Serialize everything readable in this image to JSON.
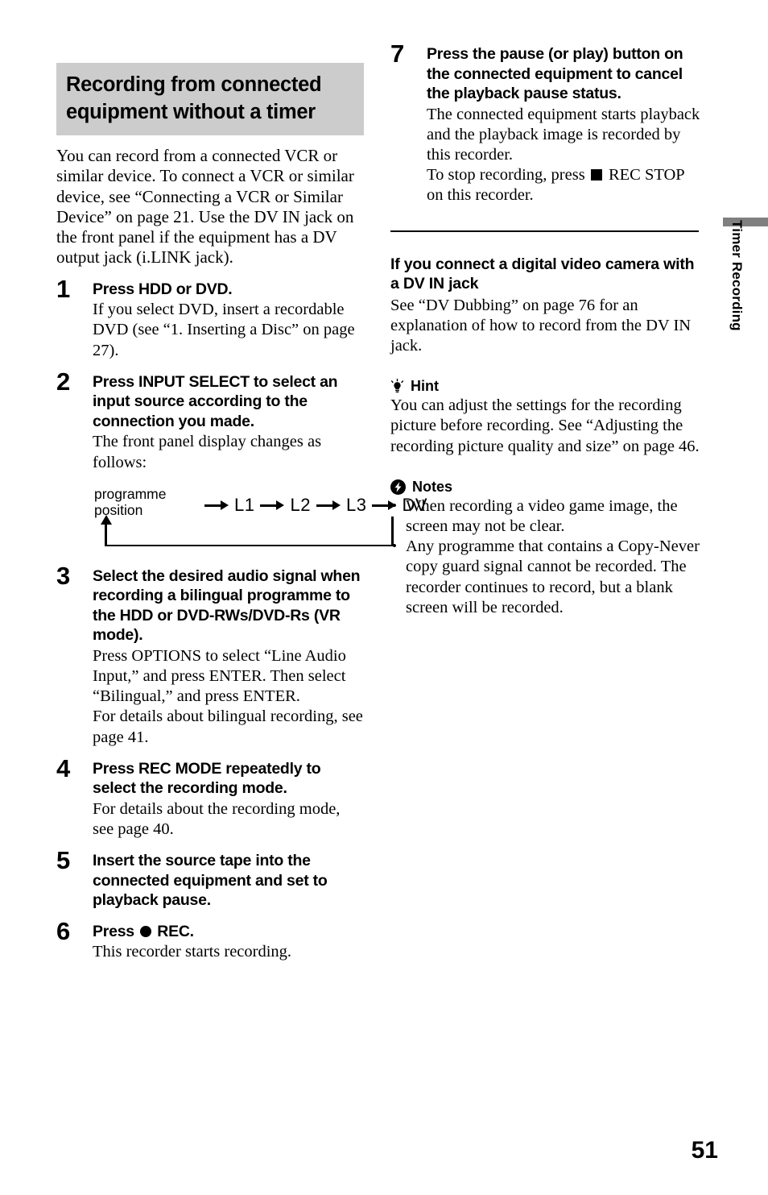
{
  "page": {
    "number": "51",
    "side_tab": "Timer Recording"
  },
  "left_column": {
    "section_heading": "Recording from connected equipment without a timer",
    "intro": "You can record from a connected VCR or similar device. To connect a VCR or similar device, see “Connecting a VCR or Similar Device” on page 21. Use the DV IN jack on the front panel if the equipment has a DV output jack (i.LINK jack).",
    "steps": [
      {
        "number": "1",
        "title": "Press HDD or DVD.",
        "body": [
          "If you select DVD, insert a recordable DVD (see “1. Inserting a Disc” on page 27)."
        ]
      },
      {
        "number": "2",
        "title": "Press INPUT SELECT to select an input source according to the connection you made.",
        "body": [
          "The front panel display changes as follows:"
        ]
      },
      {
        "number": "3",
        "title": "Select the desired audio signal when recording a bilingual programme to the HDD or DVD-RWs/DVD-Rs (VR mode).",
        "body": [
          "Press OPTIONS to select “Line Audio Input,” and press ENTER. Then select “Bilingual,” and press ENTER.",
          "For details about bilingual recording, see page 41."
        ]
      },
      {
        "number": "4",
        "title": "Press REC MODE repeatedly to select the recording mode.",
        "body": [
          "For details about the recording mode, see page 40."
        ]
      },
      {
        "number": "5",
        "title": "Insert the source tape into the connected equipment and set to playback pause.",
        "body": []
      },
      {
        "number": "6",
        "title_before_glyph": "Press ",
        "title_glyph": "record-circle-icon",
        "title_after_glyph": " REC.",
        "body": [
          "This recorder starts recording."
        ]
      }
    ],
    "diagram": {
      "label_line1": "programme",
      "label_line2": "position",
      "nodes": [
        "L1",
        "L2",
        "L3",
        "DV"
      ],
      "loops_back": true
    }
  },
  "right_column": {
    "step7": {
      "number": "7",
      "title": "Press the pause (or play) button on the connected equipment to cancel the playback pause status.",
      "body_line1": "The connected equipment starts playback and the playback image is recorded by this recorder.",
      "body_line2_before_glyph": "To stop recording, press ",
      "body_line2_glyph": "stop-square-icon",
      "body_line2_after_glyph": " REC STOP on this recorder."
    },
    "dv_section": {
      "heading": "If you connect a digital video camera with a DV IN jack",
      "body": "See “DV Dubbing” on page 76 for an explanation of how to record from the DV IN jack."
    },
    "hint": {
      "icon": "lightbulb-icon",
      "label": "Hint",
      "body": "You can adjust the settings for the recording picture before recording. See “Adjusting the recording picture quality and size” on page 46."
    },
    "notes": {
      "icon": "warning-bolt-icon",
      "label": "Notes",
      "items": [
        "When recording a video game image, the screen may not be clear.",
        "Any programme that contains a Copy-Never copy guard signal cannot be recorded. The recorder continues to record, but a blank screen will be recorded."
      ]
    }
  },
  "colors": {
    "heading_background": "#cccccc",
    "tab_bar": "#808080",
    "text": "#000000"
  }
}
